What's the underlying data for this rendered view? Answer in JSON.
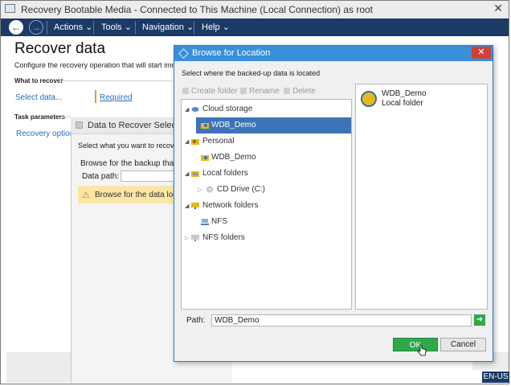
{
  "window": {
    "title": "Recovery Bootable Media - Connected to This Machine (Local Connection) as root",
    "close_glyph": "✕"
  },
  "menu": {
    "items": [
      "Actions",
      "Tools",
      "Navigation",
      "Help"
    ]
  },
  "page": {
    "title": "Recover data",
    "description": "Configure the recovery operation that will start immediately",
    "what_to_recover": "What to recover",
    "select_data": "Select data...",
    "required": "Required",
    "task_parameters": "Task parameters",
    "recovery_options": "Recovery options"
  },
  "data_panel": {
    "title": "Data to Recover Selection",
    "select_prompt": "Select what you want to recover",
    "browse_text": "Browse for the backup that contains the data",
    "data_path_label": "Data path:",
    "warning": "Browse for the data location"
  },
  "dialog": {
    "title": "Browse for Location",
    "close_glyph": "✕",
    "subtitle": "Select where the backed-up data is located",
    "toolbar": [
      "Create folder",
      "Rename",
      "Delete"
    ],
    "tree": [
      {
        "label": "Cloud storage",
        "level": 0,
        "expanded": true
      },
      {
        "label": "WDB_Demo",
        "level": 1,
        "selected": true
      },
      {
        "label": "Personal",
        "level": 0,
        "expanded": true
      },
      {
        "label": "WDB_Demo",
        "level": 1
      },
      {
        "label": "Local folders",
        "level": 0,
        "expanded": true
      },
      {
        "label": "CD Drive (C:)",
        "level": 1,
        "collapsed": true
      },
      {
        "label": "Network folders",
        "level": 0,
        "expanded": true
      },
      {
        "label": "NFS",
        "level": 1
      },
      {
        "label": "NFS folders",
        "level": 0,
        "collapsed": true
      }
    ],
    "details": {
      "name": "WDB_Demo",
      "type": "Local folder"
    },
    "path_label": "Path:",
    "path_value": "WDB_Demo",
    "ok": "OK",
    "cancel": "Cancel"
  },
  "status": {
    "language": "EN-US"
  },
  "colors": {
    "menubar": "#1b3a66",
    "dialog_title": "#3a8fd8",
    "selection": "#3d73b8",
    "ok": "#2ea84b",
    "warning_bg": "#fbe6a6"
  }
}
